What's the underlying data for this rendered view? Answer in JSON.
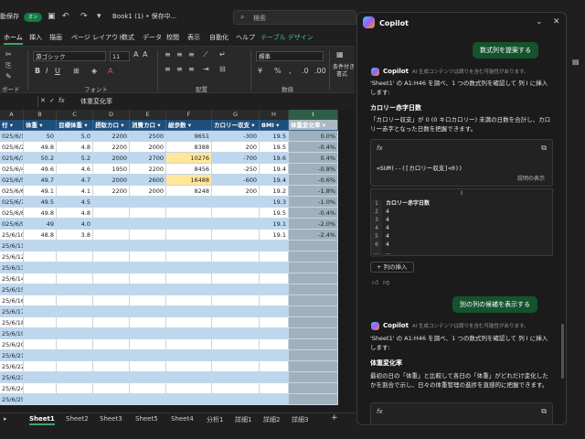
{
  "titlebar": {
    "autosave_label": "動保存",
    "autosave_state": "オン",
    "doc_title": "Book1 (1) • 保存中...",
    "search_placeholder": "検索"
  },
  "ribbon_tabs": [
    "ホーム",
    "挿入",
    "描画",
    "ページ レイアウト",
    "数式",
    "データ",
    "校閲",
    "表示",
    "自動化",
    "ヘルプ",
    "テーブル デザイン"
  ],
  "ribbon": {
    "font_name": "游ゴシック",
    "font_size": "11",
    "number_format": "標準",
    "group_clipboard": "ボード",
    "group_font": "フォント",
    "group_alignment": "配置",
    "group_number": "数値",
    "right_label_1": "条件付き",
    "right_label_2": "書式"
  },
  "formula_bar": {
    "fx": "fx",
    "content": "体重変化率"
  },
  "grid": {
    "col_letters": [
      "A",
      "B",
      "C",
      "D",
      "E",
      "F",
      "G",
      "H",
      "I"
    ],
    "headers": [
      "付",
      "体重",
      "目標体重",
      "摂取カロ",
      "消費カロ",
      "総歩数",
      "カロリー収支",
      "BMI",
      "体重変化率"
    ],
    "rows": [
      [
        "025/6/1",
        "50",
        "5.0",
        "2200",
        "2500",
        "9651",
        "-300",
        "19.5",
        "0.0%"
      ],
      [
        "025/6/2",
        "49.8",
        "4.8",
        "2200",
        "2000",
        "8388",
        "200",
        "19.5",
        "-0.4%"
      ],
      [
        "025/6/3",
        "50.2",
        "5.2",
        "2000",
        "2700",
        "10276",
        "-700",
        "19.6",
        "0.4%"
      ],
      [
        "025/6/4",
        "49.6",
        "4.6",
        "1950",
        "2200",
        "8456",
        "-250",
        "19.4",
        "-0.8%"
      ],
      [
        "025/6/5",
        "49.7",
        "4.7",
        "2000",
        "2600",
        "16488",
        "-600",
        "19.4",
        "-0.6%"
      ],
      [
        "025/6/6",
        "49.1",
        "4.1",
        "2200",
        "2000",
        "8248",
        "200",
        "19.2",
        "-1.8%"
      ],
      [
        "025/6/7",
        "49.5",
        "4.5",
        "",
        "",
        "",
        "",
        "19.3",
        "-1.0%"
      ],
      [
        "025/6/8",
        "49.8",
        "4.8",
        "",
        "",
        "",
        "",
        "19.5",
        "-0.4%"
      ],
      [
        "025/6/9",
        "49",
        "4.0",
        "",
        "",
        "",
        "",
        "19.1",
        "-2.0%"
      ],
      [
        "25/6/10",
        "48.8",
        "3.8",
        "",
        "",
        "",
        "",
        "19.1",
        "-2.4%"
      ],
      [
        "25/6/11",
        "",
        "",
        "",
        "",
        "",
        "",
        "",
        ""
      ],
      [
        "25/6/12",
        "",
        "",
        "",
        "",
        "",
        "",
        "",
        ""
      ],
      [
        "25/6/13",
        "",
        "",
        "",
        "",
        "",
        "",
        "",
        ""
      ],
      [
        "25/6/14",
        "",
        "",
        "",
        "",
        "",
        "",
        "",
        ""
      ],
      [
        "25/6/15",
        "",
        "",
        "",
        "",
        "",
        "",
        "",
        ""
      ],
      [
        "25/6/16",
        "",
        "",
        "",
        "",
        "",
        "",
        "",
        ""
      ],
      [
        "25/6/17",
        "",
        "",
        "",
        "",
        "",
        "",
        "",
        ""
      ],
      [
        "25/6/18",
        "",
        "",
        "",
        "",
        "",
        "",
        "",
        ""
      ],
      [
        "25/6/19",
        "",
        "",
        "",
        "",
        "",
        "",
        "",
        ""
      ],
      [
        "25/6/20",
        "",
        "",
        "",
        "",
        "",
        "",
        "",
        ""
      ],
      [
        "25/6/21",
        "",
        "",
        "",
        "",
        "",
        "",
        "",
        ""
      ],
      [
        "25/6/22",
        "",
        "",
        "",
        "",
        "",
        "",
        "",
        ""
      ],
      [
        "25/6/23",
        "",
        "",
        "",
        "",
        "",
        "",
        "",
        ""
      ],
      [
        "25/6/24",
        "",
        "",
        "",
        "",
        "",
        "",
        "",
        ""
      ],
      [
        "25/6/25",
        "",
        "",
        "",
        "",
        "",
        "",
        "",
        ""
      ]
    ],
    "highlight_values": [
      "10276",
      "16488"
    ]
  },
  "sheet_tabs": [
    "Sheet1",
    "Sheet2",
    "Sheet3",
    "Sheet5",
    "Sheet4",
    "分析1",
    "詳細1",
    "詳細2",
    "詳細3"
  ],
  "copilot": {
    "title": "Copilot",
    "user_msg_1": "数式列を提案する",
    "ai_name": "Copilot",
    "ai_note": "AI 生成コンテンツは誤りを含む可能性があります。",
    "intro_1": "'Sheet1' の A1:H46 を調べ、1 つの数式列を確認して 列 I に挿入します:",
    "col_title_1": "カロリー赤字日数",
    "desc_1": "「カロリー収支」が 0 (0 キロカロリー) 未満の日数を合計し、カロリー赤字となった日数を把握できます。",
    "formula_fx": "fx",
    "formula_1": "=SUM(--([カロリー収支]<0))",
    "explain": "説明の表示",
    "preview_col": "I",
    "preview_header": "カロリー赤字日数",
    "preview_rows": [
      [
        "1",
        "カロリー赤字日数"
      ],
      [
        "2",
        "4"
      ],
      [
        "3",
        "4"
      ],
      [
        "4",
        "4"
      ],
      [
        "5",
        "4"
      ],
      [
        "6",
        "4"
      ],
      [
        "...",
        "..."
      ]
    ],
    "insert_btn": "列の挿入",
    "user_msg_2": "別の列の候補を表示する",
    "intro_2": "'Sheet1' の A1:H46 を調べ、1 つの数式列を確認して 列 I に挿入します:",
    "col_title_2": "体重変化率",
    "desc_2": "最初の日の「体重」と比較して各日の「体重」がどれだけ変化したかを割合で示し、日々の体重管理の進捗を直感的に把握できます。"
  }
}
